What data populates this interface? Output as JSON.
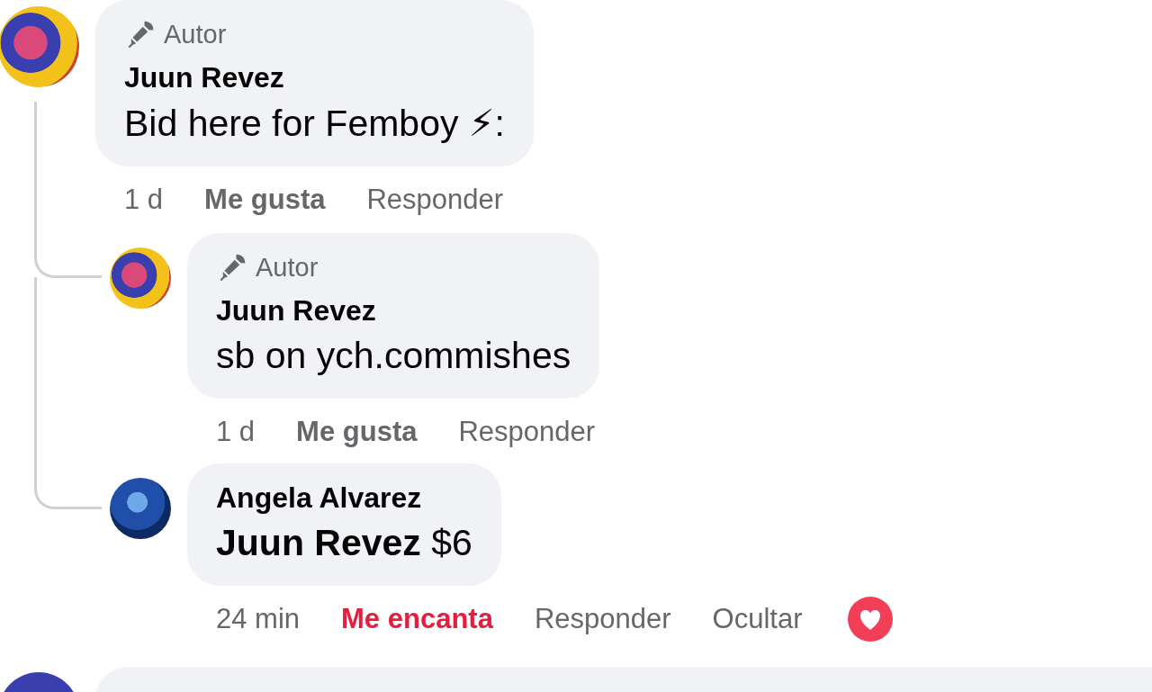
{
  "comments": [
    {
      "author_badge": "Autor",
      "name": "Juun Revez",
      "text": "Bid here for Femboy ⚡:",
      "time": "1 d",
      "like": {
        "label": "Me gusta",
        "reacted": false
      },
      "actions": [
        "Responder"
      ],
      "replies": [
        {
          "author_badge": "Autor",
          "name": "Juun Revez",
          "text": "sb on ych.commishes",
          "time": "1 d",
          "like": {
            "label": "Me gusta",
            "reacted": false
          },
          "actions": [
            "Responder"
          ]
        },
        {
          "name": "Angela Alvarez",
          "text": "**Juun Revez** $6",
          "time": "24 min",
          "like": {
            "label": "Me encanta",
            "reacted": true
          },
          "actions": [
            "Responder",
            "Ocultar"
          ]
        }
      ]
    }
  ]
}
